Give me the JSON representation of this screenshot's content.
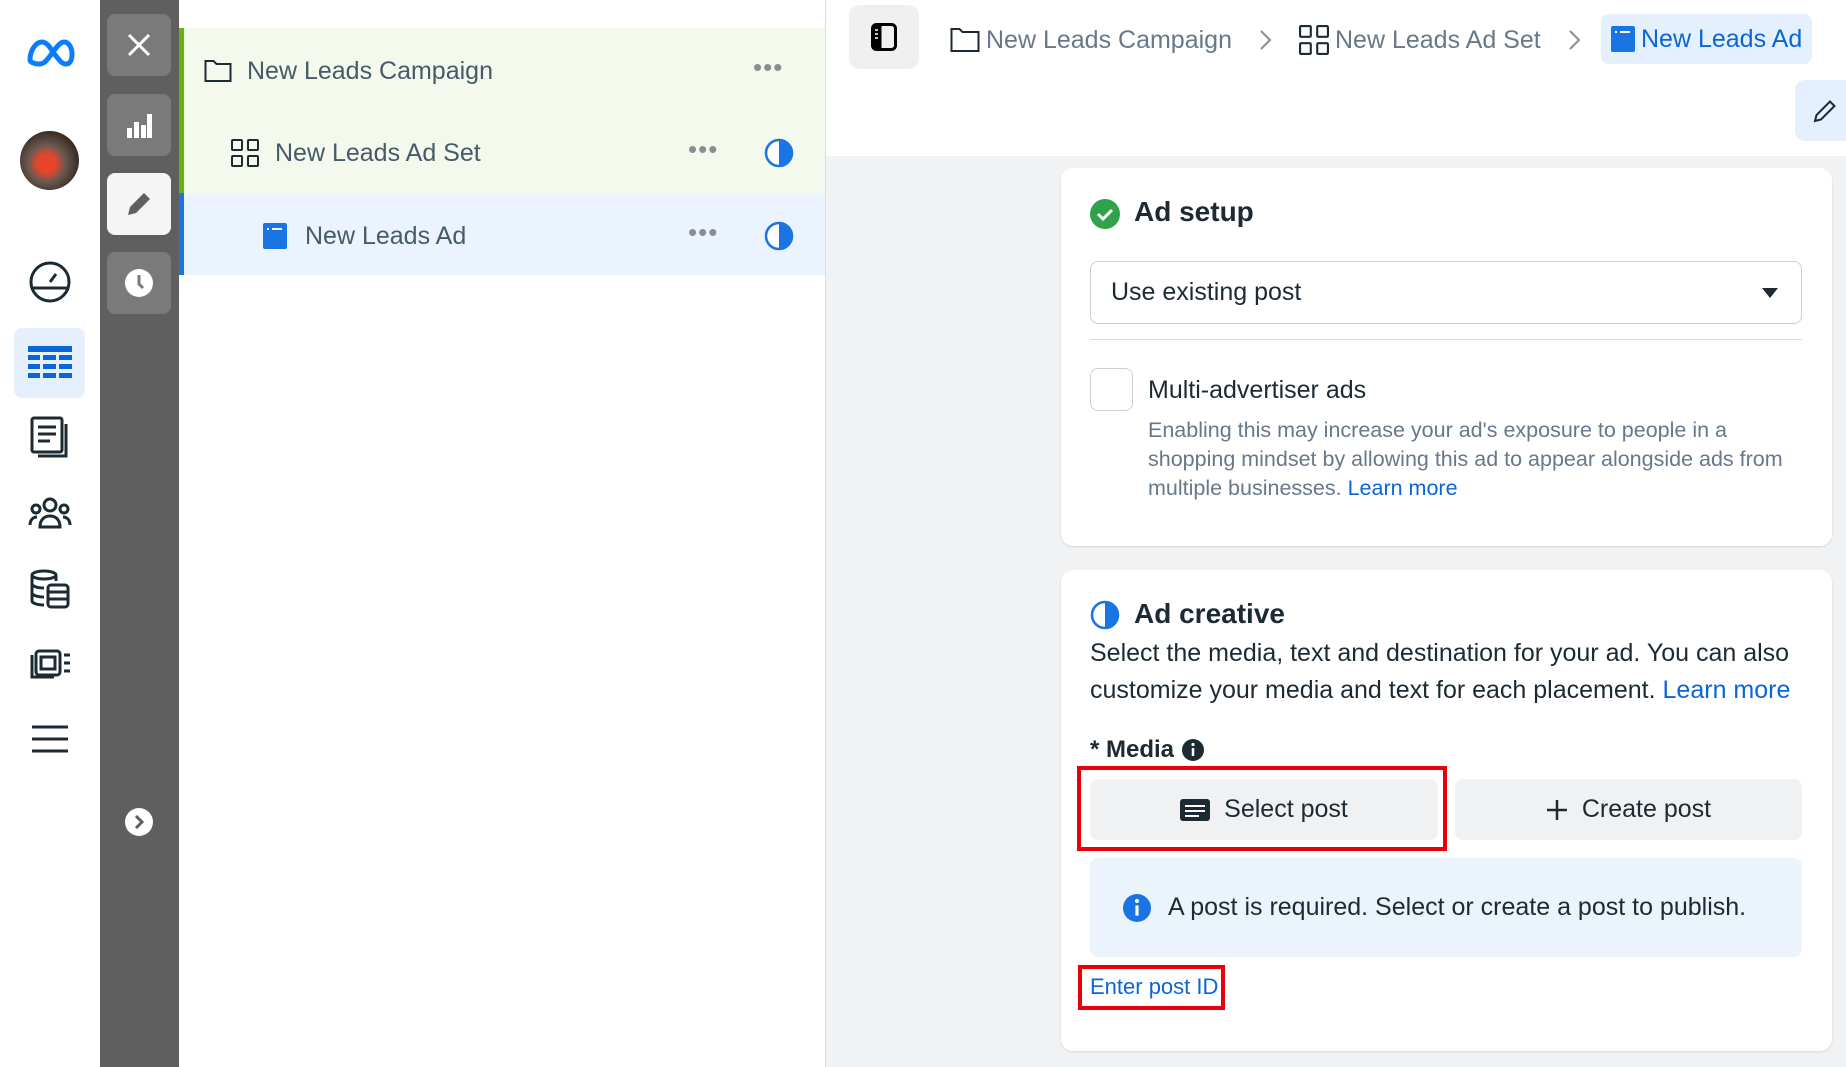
{
  "tree": {
    "campaign": {
      "label": "New Leads Campaign"
    },
    "ad_set": {
      "label": "New Leads Ad Set"
    },
    "ad": {
      "label": "New Leads Ad"
    }
  },
  "breadcrumb": [
    {
      "label": "New Leads Campaign"
    },
    {
      "label": "New Leads Ad Set"
    },
    {
      "label": "New Leads Ad"
    }
  ],
  "ad_setup": {
    "title": "Ad setup",
    "status": "complete",
    "dropdown_value": "Use existing post",
    "multi_advertiser": {
      "label": "Multi-advertiser ads",
      "checked": false,
      "description": "Enabling this may increase your ad's exposure to people in a shopping mindset by allowing this ad to appear alongside ads from multiple businesses.",
      "learn_more": "Learn more"
    }
  },
  "ad_creative": {
    "title": "Ad creative",
    "status": "in-progress",
    "description": "Select the media, text and destination for your ad. You can also customize your media and text for each placement.",
    "learn_more": "Learn more",
    "media_label": "* Media",
    "select_post": "Select post",
    "create_post": "Create post",
    "notice": "A post is required. Select or create a post to publish.",
    "enter_post_id": "Enter post ID"
  },
  "colors": {
    "accent": "#0a66d6",
    "success": "#31a24c",
    "highlight": "#e8000b",
    "campaign_row": "#f3f9ec",
    "ad_row": "#ebf4fe"
  }
}
